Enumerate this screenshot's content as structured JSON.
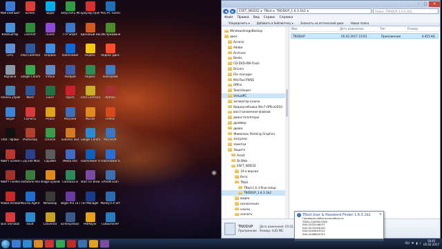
{
  "desktop": {
    "icons": [
      {
        "label": "Мой компьютер",
        "color": "#3a7bd5"
      },
      {
        "label": "Screen",
        "color": "#e03b3b"
      },
      {
        "label": "Skype",
        "color": "#00aff0"
      },
      {
        "label": "Запустить Windows",
        "color": "#2f9e44"
      },
      {
        "label": "Браузер Opera",
        "color": "#d83030"
      },
      {
        "label": "AVG PC TuneUp 2015",
        "color": "#1e6fb8"
      },
      {
        "label": "Компьютер",
        "color": "#4a90d9"
      },
      {
        "label": "uTorrent",
        "color": "#2e8b3b"
      },
      {
        "label": "iTunes",
        "color": "#8a4bd8"
      },
      {
        "label": "FTP Smart",
        "color": "#3c78c8"
      },
      {
        "label": "Дисковый менеджер",
        "color": "#d05a20"
      },
      {
        "label": "Обслуживание",
        "color": "#4a8c2a"
      },
      {
        "label": "Сеть",
        "color": "#5b8fd6"
      },
      {
        "label": "Total Commander",
        "color": "#2c5aa0"
      },
      {
        "label": "Dropbox",
        "color": "#3d8ee6"
      },
      {
        "label": "TeamViewer",
        "color": "#0e6ad6"
      },
      {
        "label": "Яндекс",
        "color": "#f2c811"
      },
      {
        "label": "Яндекс Диск",
        "color": "#ff4b2b"
      },
      {
        "label": "Корзина",
        "color": "#8899aa"
      },
      {
        "label": "Google Chrome",
        "color": "#34a853"
      },
      {
        "label": "Virtual",
        "color": "#5a8cc8"
      },
      {
        "label": "Akelpad",
        "color": "#3b5ea8"
      },
      {
        "label": "Яндекс",
        "color": "#2e8b57"
      },
      {
        "label": "Teamspeak",
        "color": "#3b7dc6"
      },
      {
        "label": "Панель управления",
        "color": "#4682b4"
      },
      {
        "label": "Word",
        "color": "#2b579a"
      },
      {
        "label": "Excel",
        "color": "#217346"
      },
      {
        "label": "Opera",
        "color": "#cc1f2e"
      },
      {
        "label": "Total Commander",
        "color": "#c9b02a"
      },
      {
        "label": "Aptana",
        "color": "#a53030"
      },
      {
        "label": "Skype",
        "color": "#3c84d8"
      },
      {
        "label": "Скачать",
        "color": "#d83a3a"
      },
      {
        "label": "Picasa",
        "color": "#dba21a"
      },
      {
        "label": "Рисунки",
        "color": "#3e6fba"
      },
      {
        "label": "Mozilla",
        "color": "#e0891f"
      },
      {
        "label": "Firefox",
        "color": "#d64a1a"
      },
      {
        "label": "cmd - Ярлык",
        "color": "#111111"
      },
      {
        "label": "Photoshop",
        "color": "#b0402a"
      },
      {
        "label": "Chrome",
        "color": "#3a9b4a"
      },
      {
        "label": "Sublime Text",
        "color": "#d67a20"
      },
      {
        "label": "Google Chrome",
        "color": "#2a8ad6"
      },
      {
        "label": "Microsoft",
        "color": "#3777c3"
      },
      {
        "label": "ABBYY Screensh...",
        "color": "#b7372f"
      },
      {
        "label": "F-Zip File Manager",
        "color": "#2b3f8a"
      },
      {
        "label": "Clip2Net",
        "color": "#5b5b5b"
      },
      {
        "label": "Media Info",
        "color": "#3f6bc8"
      },
      {
        "label": "TeamViewer 9",
        "color": "#0f5fc0"
      },
      {
        "label": "TeamViewer 64-bit",
        "color": "#2a6fd6"
      },
      {
        "label": "ABBYY FineReade...",
        "color": "#a0302a"
      },
      {
        "label": "FastStone Image Viewer",
        "color": "#3a7a3a"
      },
      {
        "label": "Image Uploader",
        "color": "#e08a1a"
      },
      {
        "label": "Camtasia 8",
        "color": "#2a8a5a"
      },
      {
        "label": "Start Tor Browser",
        "color": "#7a4ba0"
      },
      {
        "label": "EPSON Scan",
        "color": "#3b6fb0"
      },
      {
        "label": "Adobe Acrobat DC",
        "color": "#c62828"
      },
      {
        "label": "Mail.Ru Agent",
        "color": "#1f6fd0"
      },
      {
        "label": "Mimomap",
        "color": "#3a3a3a"
      },
      {
        "label": "Vegas Pro 14.0 (64-bit)",
        "color": "#6a3aa0"
      },
      {
        "label": "Far Manager",
        "color": "#1a3a8a"
      },
      {
        "label": "MoneyTFX EPSON Scan",
        "color": "#2a6ab0"
      },
      {
        "label": "Skin Uninstall",
        "color": "#d63a3a"
      },
      {
        "label": "Ravit",
        "color": "#2a8aca"
      },
      {
        "label": "Convertor",
        "color": "#c8a020"
      },
      {
        "label": "Screenpresso v2.0",
        "color": "#3a5a8a"
      },
      {
        "label": "PotPlayer",
        "color": "#e8a01a"
      },
      {
        "label": "CDBurnerXP",
        "color": "#2a7ac0"
      }
    ]
  },
  "explorer": {
    "breadcrumb": [
      "ESET_NOD32",
      "TNod",
      "TNODUP_1.6.3.1b2"
    ],
    "search_placeholder": "Поиск: TNODUP_1.6.3.1b2",
    "menu": [
      "Файл",
      "Правка",
      "Вид",
      "Сервис",
      "Справка"
    ],
    "toolbar": [
      "Упорядочить ▾",
      "Добавить в библиотеку ▾",
      "Записать на оптический диск",
      "Новая папка"
    ],
    "tree": [
      {
        "label": "WindowsImageBackup",
        "indent": 0,
        "selected": false
      },
      {
        "label": "диск",
        "indent": 0,
        "selected": false
      },
      {
        "label": "Acronis",
        "indent": 1,
        "selected": false
      },
      {
        "label": "Adobe",
        "indent": 1,
        "selected": false
      },
      {
        "label": "Archives",
        "indent": 1,
        "selected": false
      },
      {
        "label": "Books",
        "indent": 1,
        "selected": false
      },
      {
        "label": "CD-DVD-RW-Flash",
        "indent": 1,
        "selected": false
      },
      {
        "label": "Drivers",
        "indent": 1,
        "selected": false
      },
      {
        "label": "File manager",
        "indent": 1,
        "selected": false
      },
      {
        "label": "MiniTool PWSE",
        "indent": 1,
        "selected": false
      },
      {
        "label": "Office",
        "indent": 1,
        "selected": false
      },
      {
        "label": "TeamViewer",
        "indent": 1,
        "selected": false
      },
      {
        "label": "VirtualPC",
        "indent": 1,
        "selected": true
      },
      {
        "label": "активатор ключи",
        "indent": 1,
        "selected": false
      },
      {
        "label": "Видеоучебники Win7-Office2010",
        "indent": 1,
        "selected": false
      },
      {
        "label": "восстановление файлов",
        "indent": 1,
        "selected": false
      },
      {
        "label": "деинсталляторы",
        "indent": 1,
        "selected": false
      },
      {
        "label": "драйвер",
        "indent": 1,
        "selected": false
      },
      {
        "label": "дрова",
        "indent": 1,
        "selected": false
      },
      {
        "label": "Живопись Painting Graphics",
        "indent": 1,
        "selected": false
      },
      {
        "label": "загрузки",
        "indent": 1,
        "selected": false
      },
      {
        "label": "заметки",
        "indent": 1,
        "selected": false
      },
      {
        "label": "Защита",
        "indent": 1,
        "selected": false
      },
      {
        "label": "Avast",
        "indent": 2,
        "selected": false
      },
      {
        "label": "Dr.Web",
        "indent": 2,
        "selected": false
      },
      {
        "label": "ESET_NOD32",
        "indent": 2,
        "selected": false
      },
      {
        "label": "10-я версия",
        "indent": 3,
        "selected": false
      },
      {
        "label": "бета",
        "indent": 3,
        "selected": false
      },
      {
        "label": "TNod",
        "indent": 3,
        "selected": false
      },
      {
        "label": "TNod-1.6.3-final-setup",
        "indent": 4,
        "selected": false
      },
      {
        "label": "TNODUP_1.6.3.1b2",
        "indent": 4,
        "selected": true
      },
      {
        "label": "видео",
        "indent": 3,
        "selected": false
      },
      {
        "label": "исключения",
        "indent": 3,
        "selected": false
      },
      {
        "label": "ключи",
        "indent": 3,
        "selected": false
      },
      {
        "label": "скачать",
        "indent": 3,
        "selected": false
      },
      {
        "label": "текущие лицензии",
        "indent": 3,
        "selected": false
      },
      {
        "label": "установка",
        "indent": 3,
        "selected": false
      },
      {
        "label": "видео",
        "indent": 2,
        "selected": false
      },
      {
        "label": "Защита банковской оплаты",
        "indent": 2,
        "selected": false
      },
      {
        "label": "ключи лицензии",
        "indent": 2,
        "selected": false
      },
      {
        "label": "параметры",
        "indent": 2,
        "selected": false
      }
    ],
    "columns": [
      "Имя",
      "Дата изменения",
      "Тип",
      "Размер"
    ],
    "files": [
      {
        "name": "TNODUP",
        "date": "05.02.2017 23:01",
        "type": "Приложение",
        "size": "4 815 КБ"
      }
    ],
    "details": {
      "name": "TNODUP",
      "type": "Приложение",
      "modified": "Дата изменения: 05.02.2017 23:01",
      "size": "Размер: 4,81 МБ",
      "created": "Дата создания: 05.02.2017 23:01"
    }
  },
  "toast": {
    "title": "TNod User & Password Finder 1.6.3.1b2",
    "lines": [
      "Проверка работоспособности",
      "TRIAL-0269003780",
      "EAV-0232448037",
      "EAV-0233394040",
      "EAV-0265653021",
      "EAV-0268802051"
    ]
  },
  "taskbar": {
    "items": [
      "#3a7bd5",
      "#2a8ad6",
      "#e0891f",
      "#d83030",
      "#34a853",
      "#c62828",
      "#3b6fb0",
      "#e8a01a",
      "#7a4ba0"
    ],
    "lang": "RU",
    "time": "18:45",
    "date": "05.02.2017"
  }
}
